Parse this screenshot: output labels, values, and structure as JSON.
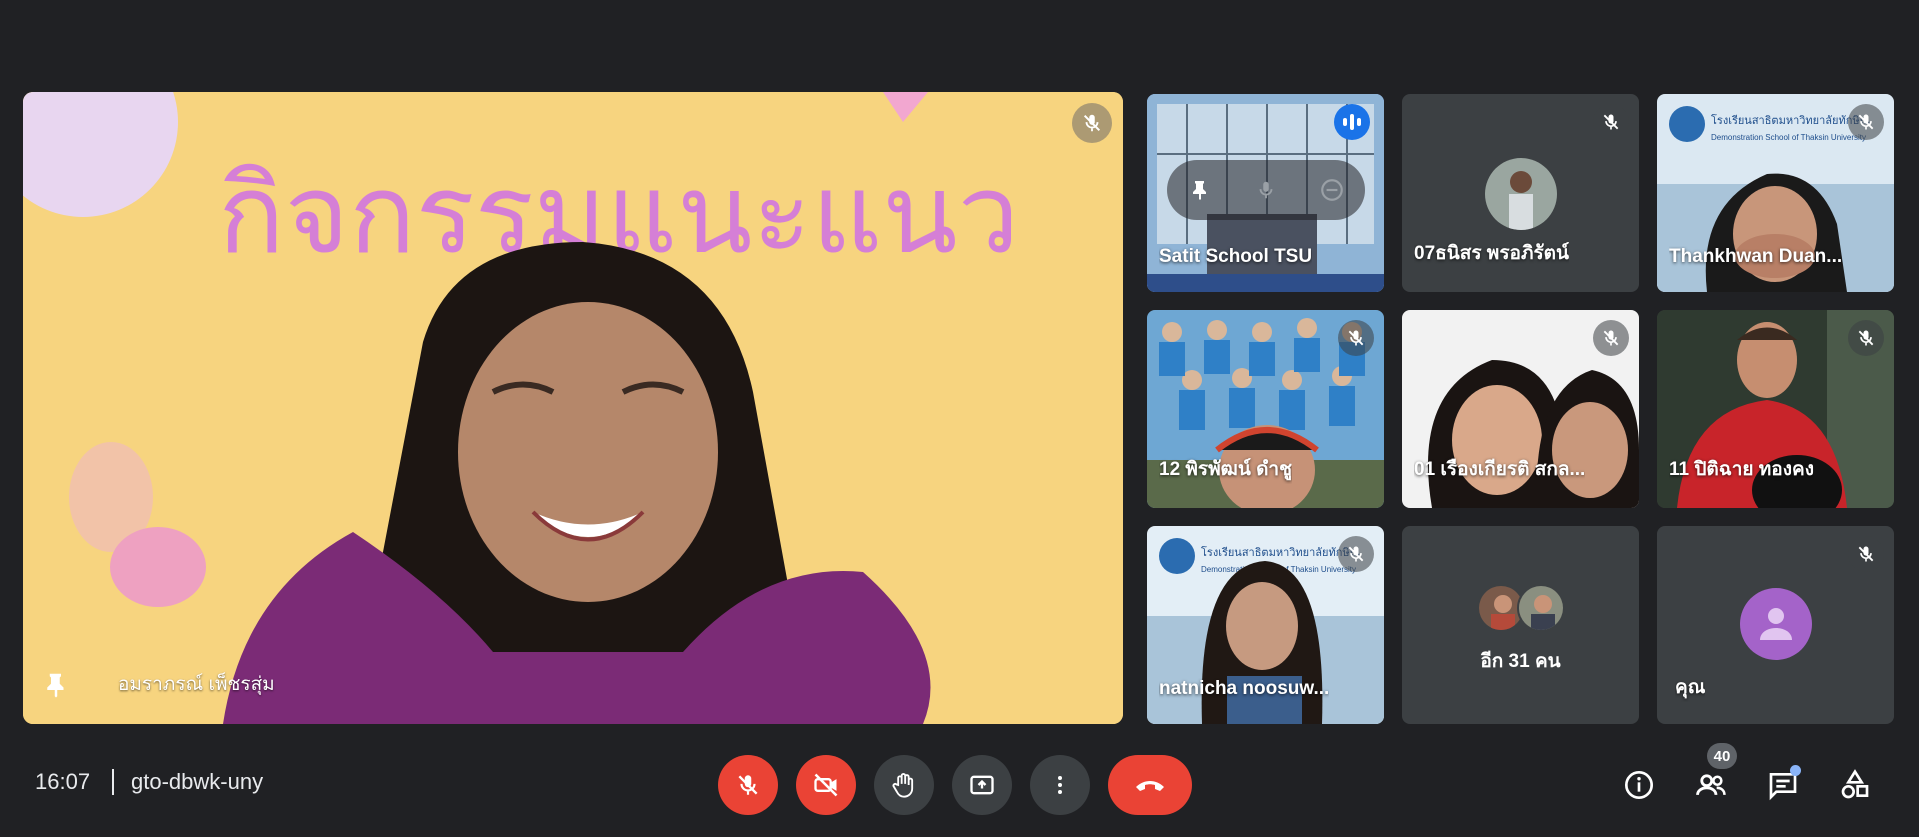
{
  "main_speaker": {
    "name": "อมราภรณ์ เพ็ชรสุ่ม",
    "background_text": "กิจกรรมแนะแนว",
    "pinned": true,
    "muted": true
  },
  "tiles": [
    {
      "id": "satit",
      "name": "Satit School TSU",
      "speaking": true,
      "hover_controls": [
        "pin-icon",
        "mic-icon",
        "remove-icon"
      ]
    },
    {
      "id": "tanisorn",
      "name": "07ธนิสร พรอภิรัตน์",
      "muted": true
    },
    {
      "id": "thankhwan",
      "name": "Thankhwan Duan...",
      "muted": true,
      "banner_text": "โรงเรียนสาธิตมหาวิทยาลัยทักษิณ",
      "banner_subtext": "Demonstration School of Thaksin University"
    },
    {
      "id": "piraphat",
      "name": "12 พิรพัฒน์ ดำชู",
      "muted": true
    },
    {
      "id": "ruangkiat",
      "name": "01 เรืองเกียรติ สกล...",
      "muted": true
    },
    {
      "id": "pitichai",
      "name": "11 ปิติฉาย ทองคง",
      "muted": true
    },
    {
      "id": "natnicha",
      "name": "natnicha noosuw...",
      "muted": true,
      "banner_text": "โรงเรียนสาธิตมหาวิทยาลัยทักษิณ",
      "banner_subtext": "Demonstration School of Thaksin University"
    },
    {
      "id": "others",
      "name": "อีก 31 คน"
    },
    {
      "id": "self",
      "name": "คุณ",
      "muted": true
    }
  ],
  "bottom_bar": {
    "time": "16:07",
    "meeting_code": "gto-dbwk-uny",
    "participants_count": "40"
  },
  "colors": {
    "background": "#202124",
    "tile": "#3c4043",
    "danger": "#ea4335",
    "speaking": "#1a73e8",
    "self_avatar": "#a463c9"
  }
}
